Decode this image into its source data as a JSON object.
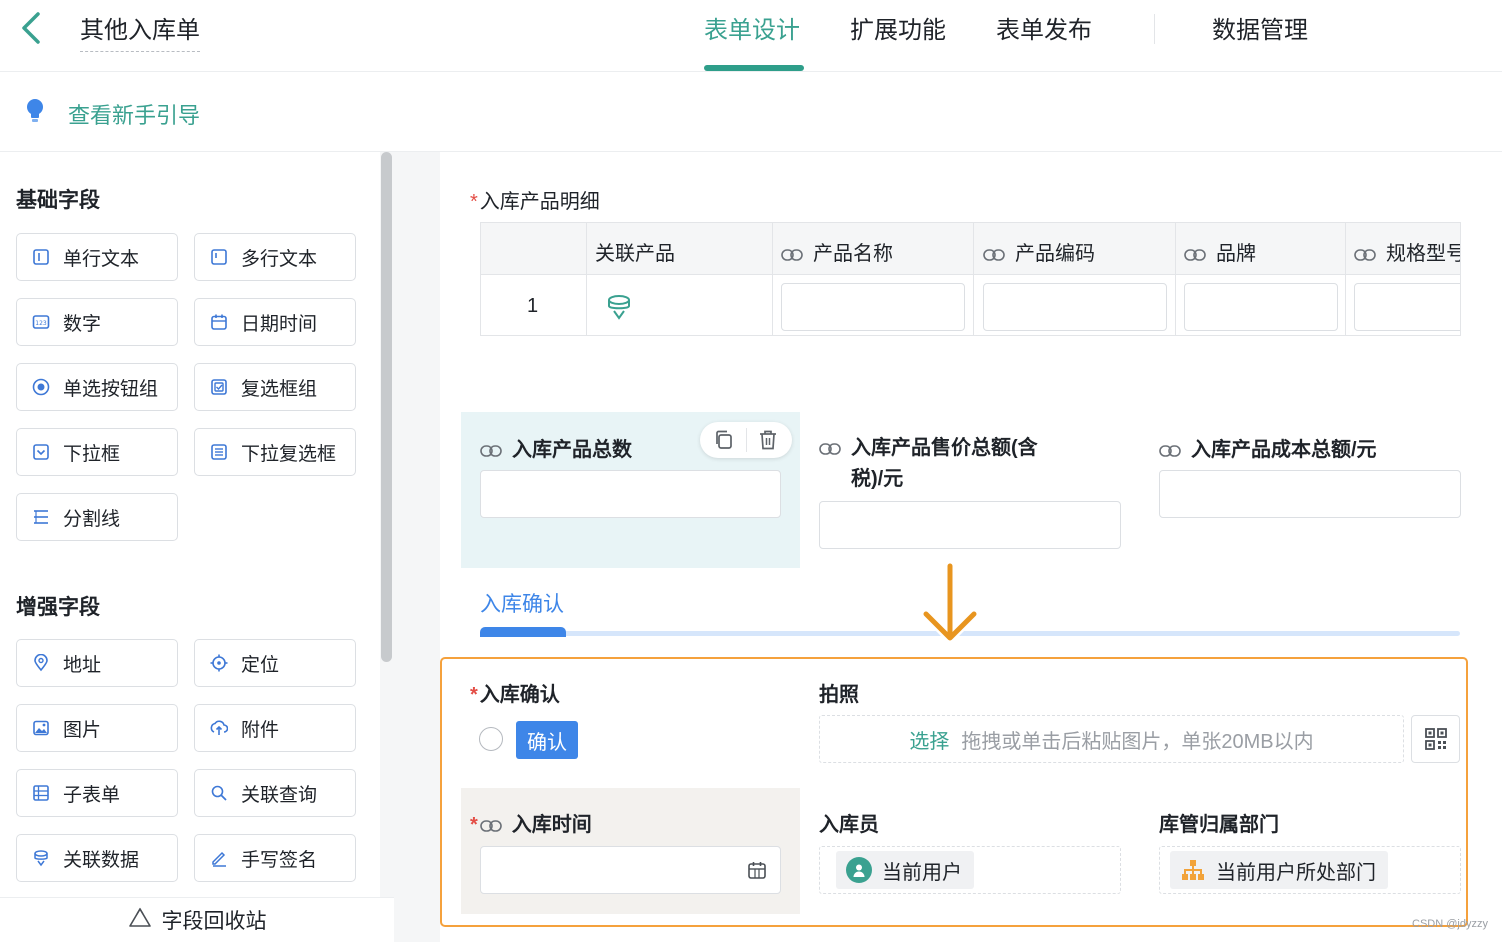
{
  "header": {
    "title": "其他入库单",
    "tabs": [
      {
        "label": "表单设计",
        "active": true
      },
      {
        "label": "扩展功能",
        "active": false
      },
      {
        "label": "表单发布",
        "active": false
      },
      {
        "label": "数据管理",
        "active": false
      }
    ],
    "accent_color": "#3aa190"
  },
  "guide": {
    "label": "查看新手引导"
  },
  "sidebar": {
    "basic_title": "基础字段",
    "basic_fields": [
      {
        "label": "单行文本",
        "icon": "single-line-text-icon"
      },
      {
        "label": "多行文本",
        "icon": "multi-line-text-icon"
      },
      {
        "label": "数字",
        "icon": "number-icon"
      },
      {
        "label": "日期时间",
        "icon": "calendar-icon"
      },
      {
        "label": "单选按钮组",
        "icon": "radio-icon"
      },
      {
        "label": "复选框组",
        "icon": "checkbox-icon"
      },
      {
        "label": "下拉框",
        "icon": "dropdown-icon"
      },
      {
        "label": "下拉复选框",
        "icon": "dropdown-multi-icon"
      },
      {
        "label": "分割线",
        "icon": "divider-icon"
      }
    ],
    "advanced_title": "增强字段",
    "advanced_fields": [
      {
        "label": "地址",
        "icon": "address-pin-icon"
      },
      {
        "label": "定位",
        "icon": "locate-icon"
      },
      {
        "label": "图片",
        "icon": "image-icon"
      },
      {
        "label": "附件",
        "icon": "attachment-icon"
      },
      {
        "label": "子表单",
        "icon": "subform-icon"
      },
      {
        "label": "关联查询",
        "icon": "linked-query-icon"
      },
      {
        "label": "关联数据",
        "icon": "linked-data-icon"
      },
      {
        "label": "手写签名",
        "icon": "signature-icon"
      }
    ],
    "recycle_label": "字段回收站"
  },
  "form": {
    "detail_label": "入库产品明细",
    "table": {
      "headers": [
        "关联产品",
        "产品名称",
        "产品编码",
        "品牌",
        "规格型号"
      ],
      "row_index": "1"
    },
    "total_count_label": "入库产品总数",
    "total_price_label_line1": "入库产品售价总额(含",
    "total_price_label_line2": "税)/元",
    "total_cost_label": "入库产品成本总额/元",
    "section_tab": "入库确认",
    "confirm_label": "入库确认",
    "confirm_button": "确认",
    "photo_label": "拍照",
    "upload_pick": "选择",
    "upload_hint": "拖拽或单击后粘贴图片，单张20MB以内",
    "inbound_time_label": "入库时间",
    "operator_label": "入库员",
    "operator_value": "当前用户",
    "dept_label": "库管归属部门",
    "dept_value": "当前用户所处部门"
  },
  "watermark": "CSDN @jdyzzy"
}
